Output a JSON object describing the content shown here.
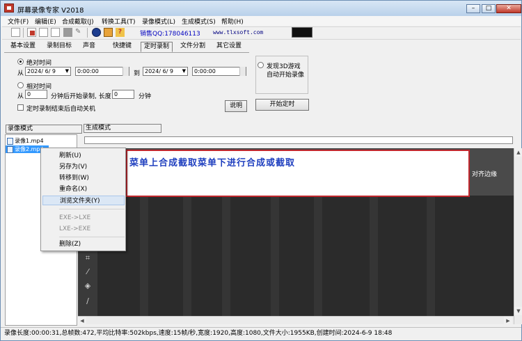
{
  "window": {
    "title": "屏幕录像专家 V2018",
    "minimize": "–",
    "maximize": "□",
    "close": "✕"
  },
  "menu": [
    "文件(F)",
    "编辑(E)",
    "合成截取(J)",
    "转换工具(T)",
    "录像模式(L)",
    "生成模式(S)",
    "帮助(H)"
  ],
  "toolbar": {
    "sales": "销售QQ:178046113",
    "site": "www.tlxsoft.com"
  },
  "tabs": [
    "基本设置",
    "录制目标",
    "声音",
    "快捷键",
    "定时录制",
    "文件分割",
    "其它设置"
  ],
  "active_tab": "定时录制",
  "timer": {
    "absolute_label": "绝对时间",
    "from": "从",
    "to": "到",
    "start_date": "2024/ 6/ 9",
    "start_time": "0:00:00",
    "end_date": "2024/ 6/ 9",
    "end_time": "0:00:00",
    "relative_label": "相对时间",
    "rel_from": "从",
    "rel_minutes": "0",
    "rel_text": "分钟后开始录制, 长度",
    "rel_length": "0",
    "rel_unit": "分钟",
    "shutdown_label": "定时录制结束后自动关机",
    "explain_button": "说明",
    "game_label": "发现3D游戏",
    "game_sub": "自动开始录像",
    "start_button": "开始定时"
  },
  "panel_tabs": {
    "record_mode": "录像模式",
    "generate_mode": "生成模式"
  },
  "files": [
    "录像1.mp4",
    "录像2.mp4"
  ],
  "context_menu": {
    "items": [
      "刷新(U)",
      "另存为(V)",
      "转移到(W)",
      "重命名(X)",
      "浏览文件夹(Y)",
      "EXE->LXE",
      "LXE->EXE",
      "删除(Z)"
    ]
  },
  "banner": {
    "text": "菜单上合成截取菜单下进行合成或截取"
  },
  "preview": {
    "align_label": "对齐边缘"
  },
  "status": {
    "text": "录像长度:00:00:31,总帧数:472,平均比特率:502kbps,速度:15帧/秒,宽度:1920,高度:1080,文件大小:1955KB,创建时间:2024-6-9 18:48"
  },
  "icons": [
    "new-icon",
    "record-icon",
    "pause-icon",
    "stop-icon",
    "camera-icon",
    "pencil-icon",
    "globe-icon",
    "gift-icon",
    "help-icon",
    "crop-icon",
    "eyedropper-icon",
    "eraser-icon",
    "brush-icon"
  ]
}
